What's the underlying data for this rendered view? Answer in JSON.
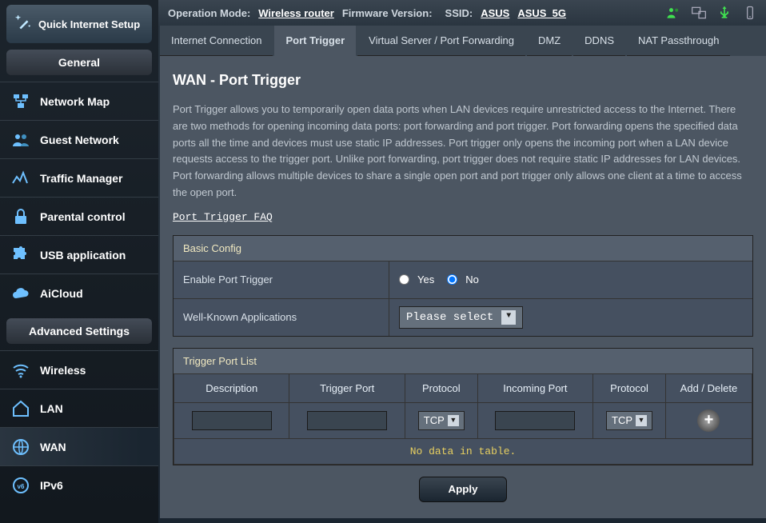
{
  "topbar": {
    "op_mode_label": "Operation Mode:",
    "op_mode_value": "Wireless router",
    "firmware_label": "Firmware Version:",
    "ssid_label": "SSID:",
    "ssid_value1": "ASUS",
    "ssid_value2": "ASUS_5G"
  },
  "sidebar": {
    "qis": "Quick Internet Setup",
    "general_title": "General",
    "general": [
      "Network Map",
      "Guest Network",
      "Traffic Manager",
      "Parental control",
      "USB application",
      "AiCloud"
    ],
    "advanced_title": "Advanced Settings",
    "advanced": [
      "Wireless",
      "LAN",
      "WAN",
      "IPv6"
    ]
  },
  "tabs": [
    "Internet Connection",
    "Port Trigger",
    "Virtual Server / Port Forwarding",
    "DMZ",
    "DDNS",
    "NAT Passthrough"
  ],
  "panel": {
    "heading": "WAN - Port Trigger",
    "description": "Port Trigger allows you to temporarily open data ports when LAN devices require unrestricted access to the Internet. There are two methods for opening incoming data ports: port forwarding and port trigger. Port forwarding opens the specified data ports all the time and devices must use static IP addresses. Port trigger only opens the incoming port when a LAN device requests access to the trigger port. Unlike port forwarding, port trigger does not require static IP addresses for LAN devices. Port forwarding allows multiple devices to share a single open port and port trigger only allows one client at a time to access the open port.",
    "faq_link": "Port Trigger FAQ"
  },
  "basic_config": {
    "section_title": "Basic Config",
    "enable_label": "Enable Port Trigger",
    "yes_label": "Yes",
    "no_label": "No",
    "apps_label": "Well-Known Applications",
    "apps_placeholder": "Please select"
  },
  "trigger_list": {
    "section_title": "Trigger Port List",
    "cols": [
      "Description",
      "Trigger Port",
      "Protocol",
      "Incoming Port",
      "Protocol",
      "Add / Delete"
    ],
    "protocol_option": "TCP",
    "no_data": "No data in table.",
    "apply": "Apply"
  }
}
